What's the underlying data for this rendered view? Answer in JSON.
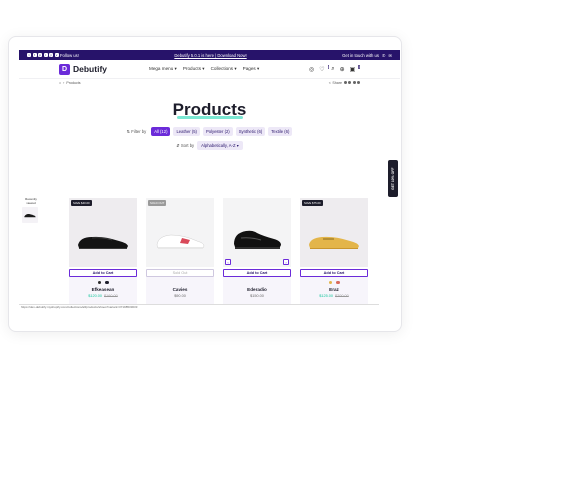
{
  "topbar": {
    "follow": "Follow us!",
    "announcement": "Debutify 5.0.1 is here | Download Now!",
    "contact": "Get in touch with us"
  },
  "brand": {
    "name": "Debutify"
  },
  "menu": [
    "Mega menu",
    "Products",
    "Collections",
    "Pages"
  ],
  "breadcrumb": {
    "current": "Products"
  },
  "share": {
    "label": "Share"
  },
  "page_title": "Products",
  "filters": {
    "label": "Filter by",
    "chips": [
      "All (12)",
      "Leather (5)",
      "Polyester (2)",
      "Synthetic (6)",
      "Textile (6)"
    ]
  },
  "sort": {
    "label": "Sort by",
    "value": "Alphabetically, A-Z"
  },
  "recently_viewed": "Recently viewed",
  "products": [
    {
      "tag": "SAVE $40.00",
      "button": "Add to Cart",
      "name": "Efkeasean",
      "price": "$120.00",
      "compare": "$160.00",
      "swatches": [
        "#2b2b2b",
        "#1d1d2b"
      ]
    },
    {
      "tag": "SOLD OUT",
      "button": "Sold Out",
      "name": "Cavies",
      "price": "$90.00",
      "compare": "",
      "swatches": []
    },
    {
      "tag": "",
      "button": "Add to Cart",
      "name": "Ederadio",
      "price": "$150.00",
      "compare": "",
      "swatches": []
    },
    {
      "tag": "SAVE $75.00",
      "button": "Add to Cart",
      "name": "Eraz",
      "price": "$125.00",
      "compare": "$200.00",
      "swatches": [
        "#e3b54a",
        "#d96a5b"
      ]
    }
  ],
  "status_url": "https://dev-debutify.myshopify.com/collections/all/products/shoes?variant=37198533033",
  "side_tab": "GET 10% OFF"
}
